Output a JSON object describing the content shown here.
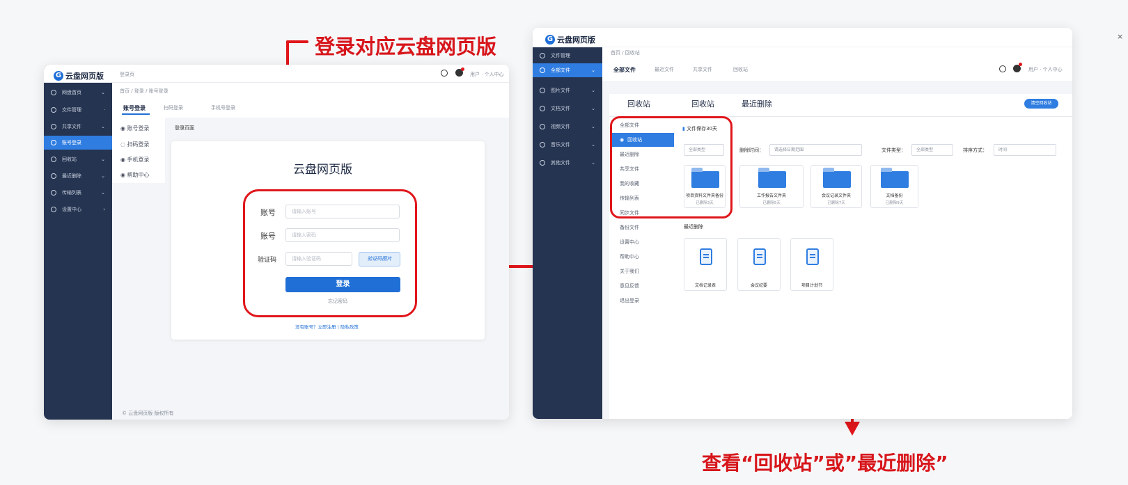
{
  "captions": {
    "top": "登录对应云盘网页版",
    "bottom": "查看“回收站”或”最近删除”"
  },
  "login_window": {
    "logo_text": "云盘网页版",
    "header_title": "登录页",
    "breadcrumb": "首页 / 登录 / 账号登录",
    "tabs": [
      "账号登录",
      "扫码登录",
      "手机号登录"
    ],
    "section_title": "登录页面",
    "sidebar": [
      "网盘首页",
      "文件管理",
      "共享文件",
      "账号登录",
      "回收站",
      "最近删除",
      "传输列表",
      "设置中心"
    ],
    "subnav": [
      "账号登录",
      "扫码登录",
      "手机登录",
      "帮助中心"
    ],
    "card_title": "云盘网页版",
    "fields": [
      {
        "label": "账号",
        "placeholder": "请输入账号"
      },
      {
        "label": "账号",
        "placeholder": "请输入密码"
      },
      {
        "label": "验证码",
        "placeholder": "请输入验证码"
      }
    ],
    "captcha_text": "验证码图片",
    "login_button": "登录",
    "forgot": "忘记密码",
    "footer_link": "没有账号？立即注册 | 隐私政策",
    "footer": "© 云盘网页版 版权所有"
  },
  "recycle_window": {
    "logo_text": "云盘网页版",
    "close_glyph": "×",
    "breadcrumb": "首页 / 回收站",
    "top_tabs": [
      "全部文件",
      "最近文件",
      "共享文件",
      "回收站"
    ],
    "sidebar": [
      "文件管理",
      "全部文件",
      "图片文件",
      "文档文件",
      "视频文件",
      "音乐文件",
      "其他文件"
    ],
    "panel_title": "回收站",
    "subnav": [
      "全部文件",
      "回收站",
      "最近删除",
      "共享文件",
      "我的收藏",
      "传输列表",
      "同步文件",
      "备份文件",
      "设置中心",
      "帮助中心",
      "关于我们",
      "意见反馈",
      "退出登录"
    ],
    "heading_recycle": "回收站",
    "heading_recent": "最近删除",
    "action_button": "清空回收站",
    "notice": "文件保存30天",
    "filters": [
      {
        "label": "",
        "value": "全部类型"
      },
      {
        "label": "删除时间：",
        "value": "请选择日期范围"
      },
      {
        "label": "文件类型：",
        "value": "全部类型"
      },
      {
        "label": "排序方式：",
        "value": "时间"
      }
    ],
    "files": [
      {
        "name": "项目资料文件夹备份",
        "meta": "已删除3天"
      },
      {
        "name": "工作报告文件夹",
        "meta": "已删除5天"
      },
      {
        "name": "会议记录文件夹",
        "meta": "已删除7天"
      },
      {
        "name": "文档备份",
        "meta": "已删除9天"
      }
    ],
    "docs_heading": "最近删除",
    "docs": [
      "文档记录表",
      "会议纪要",
      "项目计划书"
    ]
  }
}
